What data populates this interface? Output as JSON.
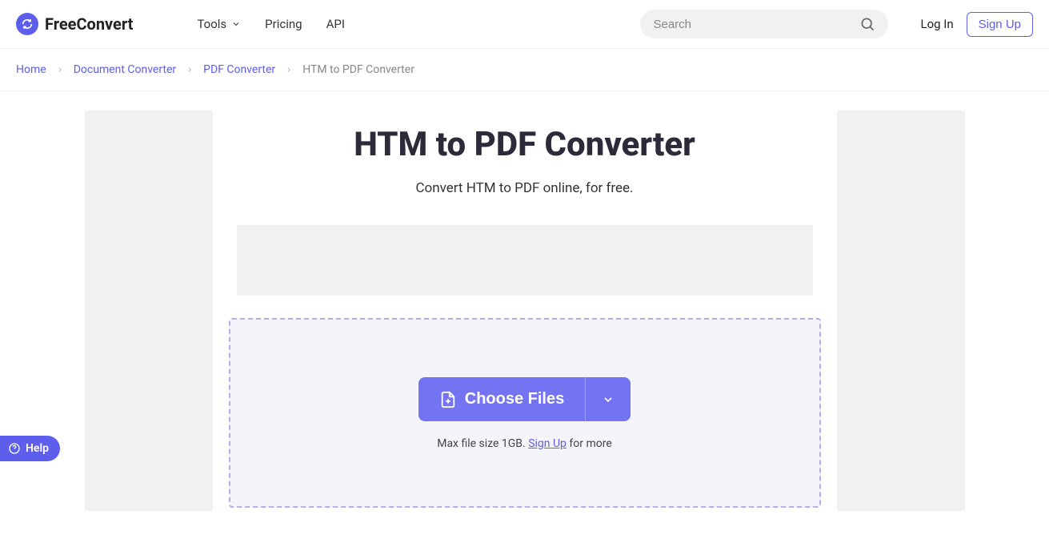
{
  "header": {
    "logo_text": "FreeConvert",
    "nav": {
      "tools": "Tools",
      "pricing": "Pricing",
      "api": "API"
    },
    "search_placeholder": "Search",
    "login": "Log In",
    "signup": "Sign Up"
  },
  "breadcrumb": {
    "items": [
      "Home",
      "Document Converter",
      "PDF Converter",
      "HTM to PDF Converter"
    ]
  },
  "page": {
    "title": "HTM to PDF Converter",
    "subtitle": "Convert HTM to PDF online, for free."
  },
  "dropzone": {
    "choose_label": "Choose Files",
    "max_prefix": "Max file size 1GB. ",
    "signup_link": "Sign Up",
    "max_suffix": " for more"
  },
  "help": {
    "label": "Help"
  }
}
